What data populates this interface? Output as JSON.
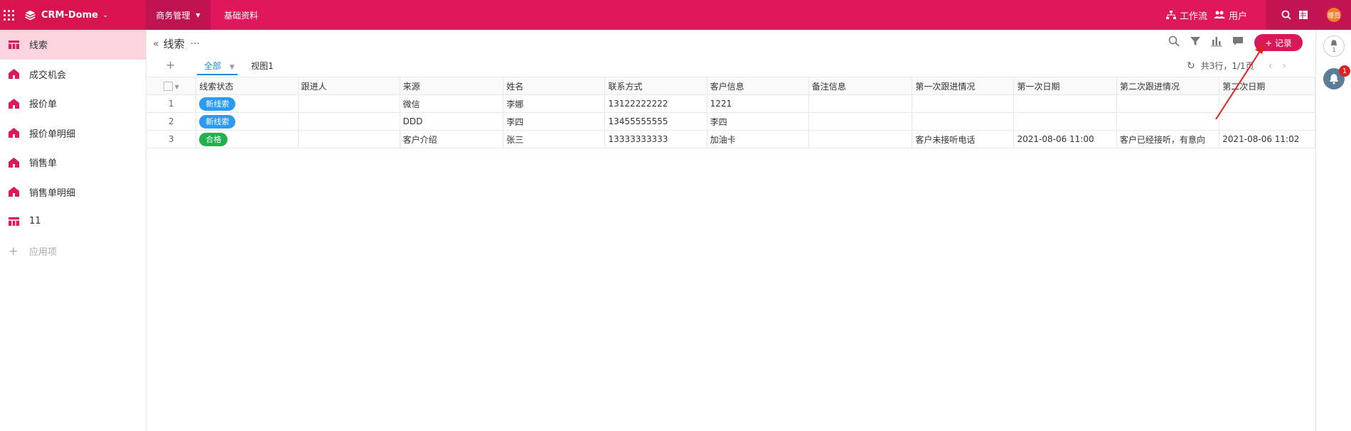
{
  "header": {
    "app_name": "CRM-Dome",
    "nav": [
      {
        "label": "商务管理"
      },
      {
        "label": "基础资料"
      }
    ],
    "workflow": "工作流",
    "users": "用户",
    "avatar": "理员"
  },
  "sidebar": {
    "items": [
      {
        "label": "线索",
        "icon": "table-icon"
      },
      {
        "label": "成交机会",
        "icon": "home-icon"
      },
      {
        "label": "报价单",
        "icon": "home-icon"
      },
      {
        "label": "报价单明细",
        "icon": "home-icon"
      },
      {
        "label": "销售单",
        "icon": "home-icon"
      },
      {
        "label": "销售单明细",
        "icon": "home-icon"
      },
      {
        "label": "11",
        "icon": "table-icon"
      }
    ],
    "add_label": "应用项"
  },
  "page": {
    "title": "线索",
    "tabs": [
      {
        "label": "全部"
      },
      {
        "label": "视图1"
      }
    ],
    "add_button": "+ 记录",
    "pager_text": "共3行，1/1页"
  },
  "table": {
    "columns": [
      "线索状态",
      "跟进人",
      "来源",
      "姓名",
      "联系方式",
      "客户信息",
      "备注信息",
      "第一次跟进情况",
      "第一次日期",
      "第二次跟进情况",
      "第二次日期"
    ],
    "rows": [
      {
        "idx": "1",
        "status": "新线索",
        "status_color": "#2b9af3",
        "follower": "",
        "source": "微信",
        "name": "李娜",
        "phone": "13122222222",
        "customer": "1221",
        "note": "",
        "first_follow": "",
        "first_date": "",
        "second_follow": "",
        "second_date": ""
      },
      {
        "idx": "2",
        "status": "新线索",
        "status_color": "#2b9af3",
        "follower": "",
        "source": "DDD",
        "name": "李四",
        "phone": "13455555555",
        "customer": "李四",
        "note": "",
        "first_follow": "",
        "first_date": "",
        "second_follow": "",
        "second_date": ""
      },
      {
        "idx": "3",
        "status": "合格",
        "status_color": "#22b14c",
        "follower": "",
        "source": "客户介绍",
        "name": "张三",
        "phone": "13333333333",
        "customer": "加油卡",
        "note": "",
        "first_follow": "客户未接听电话",
        "first_date": "2021-08-06 11:00",
        "second_follow": "客户已经接听，有意向",
        "second_date": "2021-08-06 11:02"
      }
    ]
  },
  "rightbar": {
    "bell_count": "1",
    "notify_count": "1"
  },
  "colors": {
    "brand": "#e0185b",
    "accent_blue": "#1a8ae6"
  }
}
